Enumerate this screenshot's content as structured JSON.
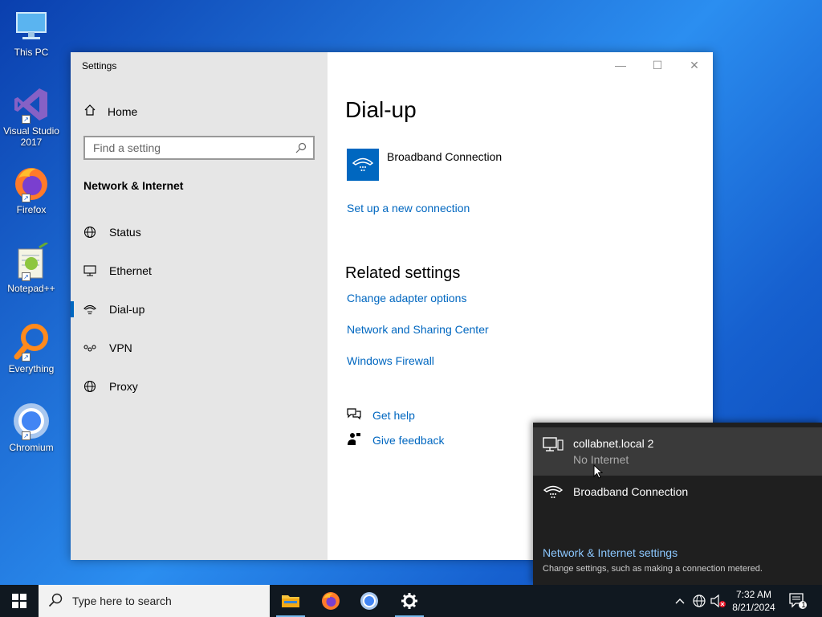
{
  "desktop": {
    "icons": [
      {
        "label": "This PC"
      },
      {
        "label": "Visual Studio 2017"
      },
      {
        "label": "Firefox"
      },
      {
        "label": "Notepad++"
      },
      {
        "label": "Everything"
      },
      {
        "label": "Chromium"
      }
    ]
  },
  "window": {
    "title": "Settings",
    "controls": {
      "minimize": "—",
      "maximize": "☐",
      "close": "✕"
    }
  },
  "sidebar": {
    "home_label": "Home",
    "search_placeholder": "Find a setting",
    "section_title": "Network & Internet",
    "items": [
      {
        "label": "Status",
        "icon": "status-globe-icon"
      },
      {
        "label": "Ethernet",
        "icon": "ethernet-icon"
      },
      {
        "label": "Dial-up",
        "icon": "dialup-icon",
        "active": true
      },
      {
        "label": "VPN",
        "icon": "vpn-icon"
      },
      {
        "label": "Proxy",
        "icon": "globe-icon"
      }
    ]
  },
  "main": {
    "title": "Dial-up",
    "connection_name": "Broadband Connection",
    "setup_link": "Set up a new connection",
    "related_title": "Related settings",
    "related_links": [
      "Change adapter options",
      "Network and Sharing Center",
      "Windows Firewall"
    ],
    "help_link": "Get help",
    "feedback_link": "Give feedback"
  },
  "flyout": {
    "networks": [
      {
        "name": "collabnet.local 2",
        "status": "No Internet",
        "icon": "network-computer-icon"
      },
      {
        "name": "Broadband Connection",
        "status": "",
        "icon": "dialup-icon"
      }
    ],
    "settings_link": "Network & Internet settings",
    "settings_desc": "Change settings, such as making a connection metered."
  },
  "taskbar": {
    "search_placeholder": "Type here to search",
    "clock_time": "7:32 AM",
    "clock_date": "8/21/2024",
    "notification_count": "1"
  },
  "colors": {
    "accent": "#0067c0",
    "sidebar_bg": "#e6e6e6",
    "flyout_bg": "#1f1f1f",
    "taskbar_bg": "#101820"
  }
}
